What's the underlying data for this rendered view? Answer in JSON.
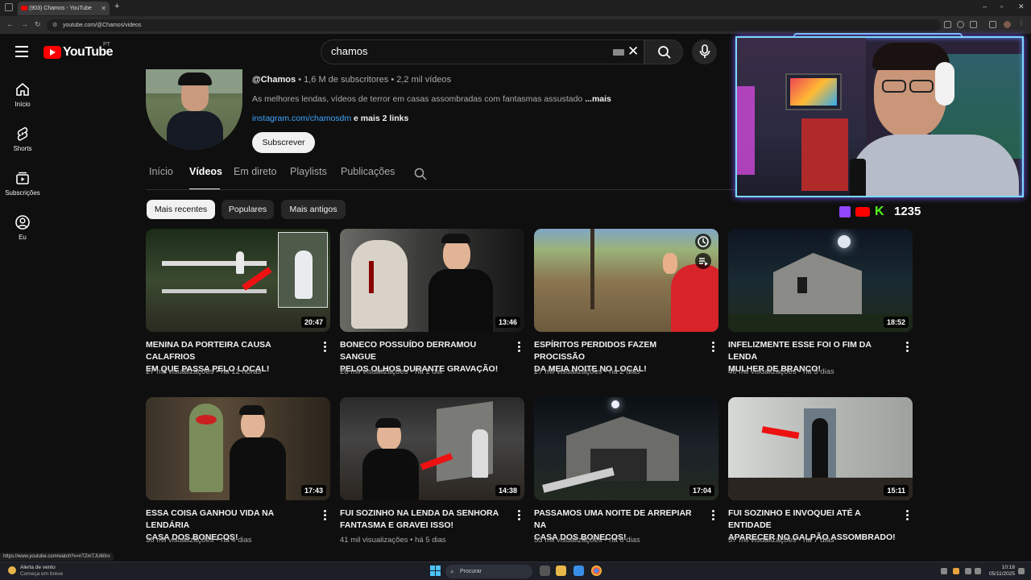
{
  "browser": {
    "tab_title": "(903) Chamos - YouTube",
    "url": "youtube.com/@Chamos/videos",
    "new_tab": "+",
    "status_url": "https://www.youtube.com/watch?v=nTZmTJU60ro"
  },
  "masthead": {
    "logo_text": "YouTube",
    "country_code": "PT",
    "search_value": "chamos"
  },
  "sidebar": {
    "items": [
      {
        "label": "Início",
        "icon": "home-icon"
      },
      {
        "label": "Shorts",
        "icon": "shorts-icon"
      },
      {
        "label": "Subscrições",
        "icon": "subscriptions-icon"
      },
      {
        "label": "Eu",
        "icon": "you-icon"
      }
    ]
  },
  "channel": {
    "handle": "@Chamos",
    "subscribers": "1,6 M de subscritores",
    "videos_count": "2,2 mil vídeos",
    "separator": "•",
    "description": "As melhores lendas, vídeos de terror em casas assombradas com fantasmas assustado",
    "more": "...mais",
    "link": "instagram.com/chamosdm",
    "more_links": "e mais 2 links",
    "subscribe_label": "Subscrever"
  },
  "tabs": [
    "Início",
    "Vídeos",
    "Em direto",
    "Playlists",
    "Publicações"
  ],
  "active_tab": "Vídeos",
  "chips": [
    "Mais recentes",
    "Populares",
    "Mais antigos"
  ],
  "videos": [
    {
      "title_1": "MENINA DA PORTEIRA CAUSA CALAFRIOS",
      "title_2": "EM QUE PASSA PELO LOCAL!",
      "views": "27 mil visualizações",
      "age": "há 12 horas",
      "duration": "20:47"
    },
    {
      "title_1": "BONECO POSSUÍDO DERRAMOU SANGUE",
      "title_2": "PELOS OLHOS DURANTE GRAVAÇÃO!",
      "views": "26 mil visualizações",
      "age": "há 1 dia",
      "duration": "13:46"
    },
    {
      "title_1": "ESPÍRITOS PERDIDOS FAZEM PROCISSÃO",
      "title_2": "DA MEIA NOITE NO LOCAL!",
      "views": "27 mil visualizações",
      "age": "há 2 dias",
      "duration": ""
    },
    {
      "title_1": "INFELIZMENTE ESSE FOI O FIM DA LENDA",
      "title_2": "MULHER DE BRANCO!",
      "views": "40 mil visualizações",
      "age": "há 3 dias",
      "duration": "18:52"
    },
    {
      "title_1": "ESSA COISA GANHOU VIDA NA LENDÁRIA",
      "title_2": "CASA DOS BONECOS!",
      "views": "36 mil visualizações",
      "age": "há 4 dias",
      "duration": "17:43"
    },
    {
      "title_1": "FUI SOZINHO NA LENDA DA SENHORA",
      "title_2": "FANTASMA E GRAVEI ISSO!",
      "views": "41 mil visualizações",
      "age": "há 5 dias",
      "duration": "14:38"
    },
    {
      "title_1": "PASSAMOS UMA NOITE DE ARREPIAR NA",
      "title_2": "CASA DOS BONECOS!",
      "views": "53 mil visualizações",
      "age": "há 6 dias",
      "duration": "17:04"
    },
    {
      "title_1": "FUI SOZINHO E INVOQUEI ATÉ A ENTIDADE",
      "title_2": "APARECER NO GALPÃO ASSOMBRADO!",
      "views": "37 mil visualizações",
      "age": "há 7 dias",
      "duration": "15:11"
    }
  ],
  "overlay": {
    "sub_count": "1235"
  },
  "taskbar": {
    "weather_title": "Alerta de vento",
    "weather_sub": "Começa em breve",
    "search_placeholder": "Procurar",
    "time": "10:18",
    "date": "05/11/2025"
  },
  "colors": {
    "background": "#0f0f0f",
    "accent_red": "#ff0000",
    "link_blue": "#3ea6ff",
    "chip_bg": "#272727",
    "chip_selected": "#f1f1f1"
  }
}
